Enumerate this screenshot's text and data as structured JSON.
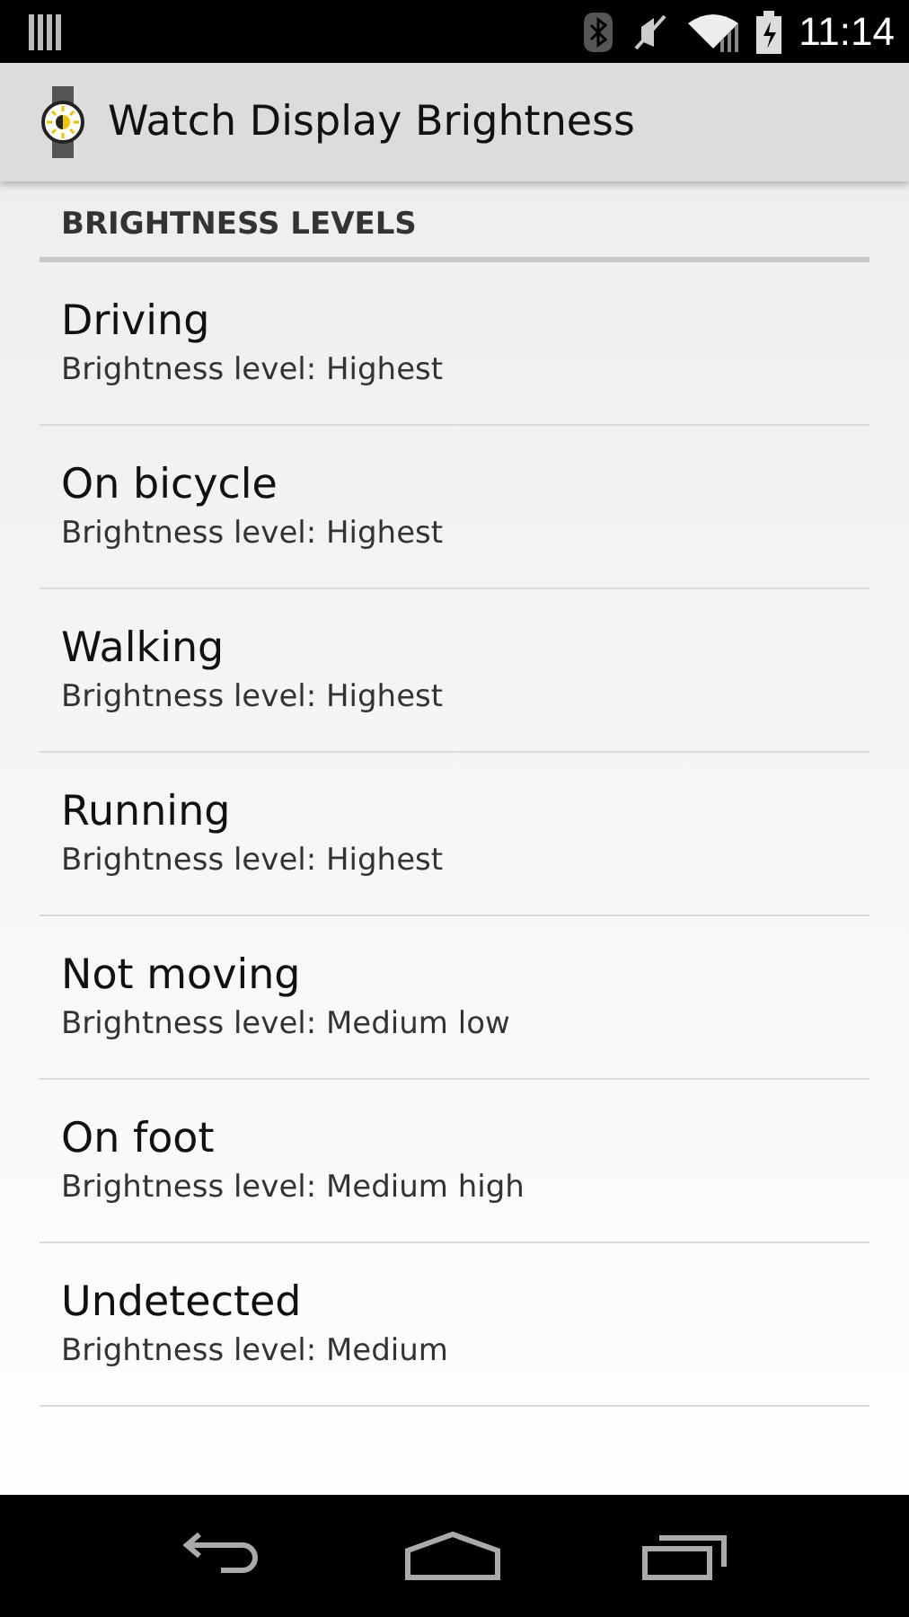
{
  "status_bar": {
    "time": "11:14"
  },
  "app_bar": {
    "title": "Watch Display Brightness"
  },
  "section": {
    "title": "BRIGHTNESS LEVELS"
  },
  "items": [
    {
      "title": "Driving",
      "summary": "Brightness level: Highest"
    },
    {
      "title": "On bicycle",
      "summary": "Brightness level: Highest"
    },
    {
      "title": "Walking",
      "summary": "Brightness level: Highest"
    },
    {
      "title": "Running",
      "summary": "Brightness level: Highest"
    },
    {
      "title": "Not moving",
      "summary": "Brightness level: Medium low"
    },
    {
      "title": "On foot",
      "summary": "Brightness level: Medium high"
    },
    {
      "title": "Undetected",
      "summary": "Brightness level: Medium"
    }
  ]
}
